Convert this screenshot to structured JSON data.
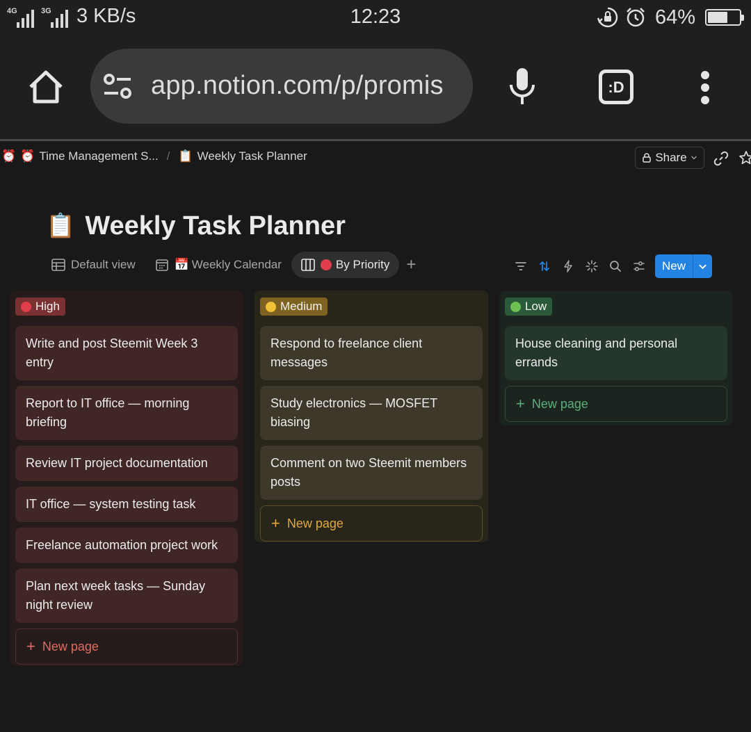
{
  "status_bar": {
    "network_tag_1": "4G",
    "network_tag_2": "3G",
    "net_speed": "3 KB/s",
    "time": "12:23",
    "battery_percent": "64%",
    "battery_level": 0.64,
    "icons": [
      "signal-icon",
      "signal-icon",
      "rotation-lock-icon",
      "alarm-icon",
      "battery-icon"
    ]
  },
  "browser": {
    "url": "app.notion.com/p/promis",
    "ext_label": ":D",
    "icons": [
      "home-icon",
      "site-settings-icon",
      "mic-icon",
      "extension-icon",
      "more-icon"
    ]
  },
  "topbar": {
    "breadcrumb_lead_icon": "⏰",
    "breadcrumb_1_icon": "⏰",
    "breadcrumb_1": "Time Management S...",
    "breadcrumb_sep": "/",
    "breadcrumb_2_icon": "📋",
    "breadcrumb_2": "Weekly Task Planner",
    "share_label": "Share"
  },
  "page": {
    "icon": "📋",
    "title": "Weekly Task Planner"
  },
  "views": {
    "tabs": [
      {
        "label": "Default view",
        "icon": "table-icon"
      },
      {
        "label": "Weekly Calendar",
        "icon": "calendar-icon",
        "emoji": "📅"
      },
      {
        "label": "By Priority",
        "icon": "board-icon",
        "active": true
      }
    ],
    "add": "+",
    "new_label": "New"
  },
  "board": {
    "columns": [
      {
        "name": "High",
        "color": "#e03e4a",
        "cards": [
          "Write and post Steemit Week 3 entry",
          "Report to IT office — morning briefing",
          "Review IT project documentation",
          "IT office — system testing task",
          "Freelance automation project work",
          "Plan next week tasks — Sunday night review"
        ],
        "new_page": "New page"
      },
      {
        "name": "Medium",
        "color": "#f2c13a",
        "cards": [
          "Respond to freelance client messages",
          "Study electronics — MOSFET biasing",
          "Comment on two Steemit members posts"
        ],
        "new_page": "New page"
      },
      {
        "name": "Low",
        "color": "#6ec052",
        "cards": [
          "House cleaning and personal errands"
        ],
        "new_page": "New page"
      }
    ]
  }
}
